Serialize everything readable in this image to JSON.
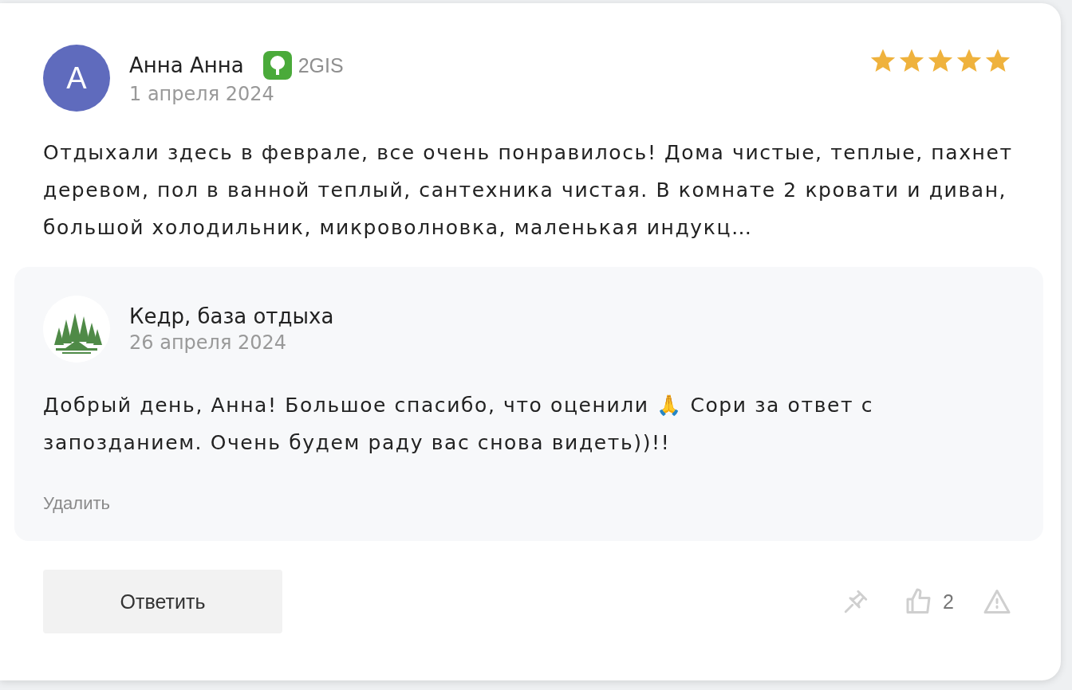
{
  "review": {
    "author": {
      "initial": "А",
      "name": "Анна Анна"
    },
    "source": {
      "label": "2GIS"
    },
    "date": "1 апреля 2024",
    "stars": 5,
    "text": "Отдыхали здесь в феврале, все очень понравилось! Дома чистые, теплые, пахнет деревом, пол в ванной теплый, сантехника чистая. В комнате 2 кровати и диван, большой холодильник, микроволновка, маленькая индукц…"
  },
  "reply": {
    "author": "Кедр, база отдыха",
    "date": "26 апреля 2024",
    "text": "Добрый день, Анна! Большое спасибо, что оценили 🙏 Сори за ответ с запозданием. Очень будем раду вас снова видеть))!!",
    "delete_label": "Удалить"
  },
  "actions": {
    "reply_button": "Ответить",
    "likes": "2"
  }
}
